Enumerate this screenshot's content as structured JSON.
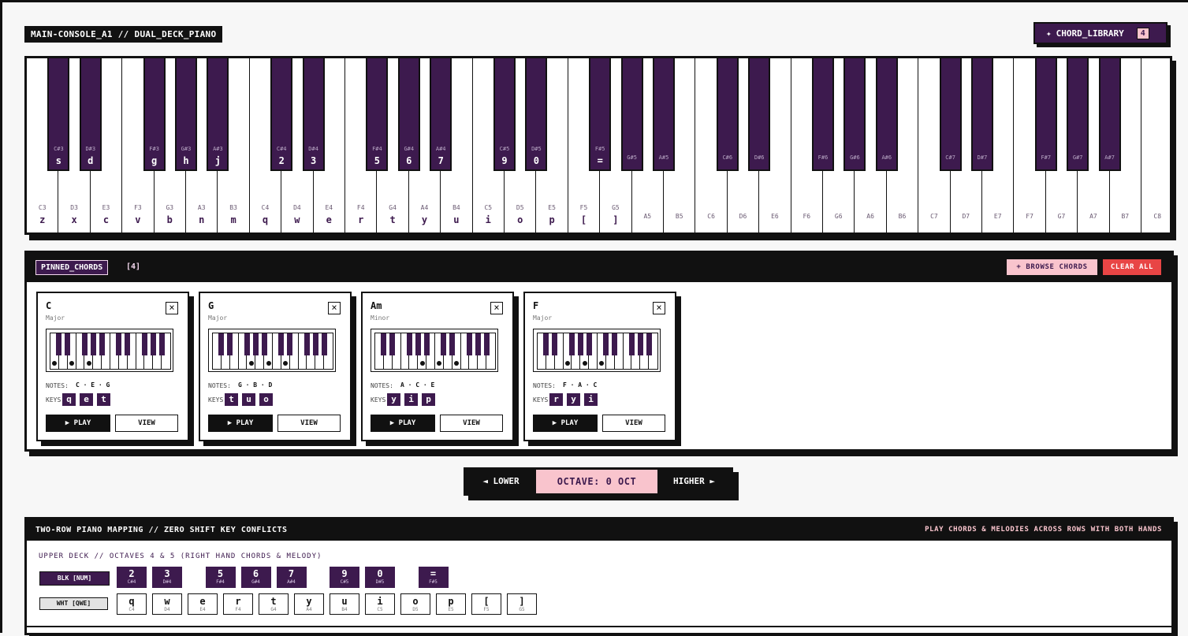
{
  "header": {
    "console_title": "MAIN-CONSOLE_A1 // DUAL_DECK_PIANO",
    "chord_library_label": "CHORD_LIBRARY",
    "chord_library_count": "4",
    "chord_library_icon": "sparkle-icon"
  },
  "keyboard": {
    "white_keys": [
      {
        "note": "C3",
        "key": "z"
      },
      {
        "note": "D3",
        "key": "x"
      },
      {
        "note": "E3",
        "key": "c"
      },
      {
        "note": "F3",
        "key": "v"
      },
      {
        "note": "G3",
        "key": "b"
      },
      {
        "note": "A3",
        "key": "n"
      },
      {
        "note": "B3",
        "key": "m"
      },
      {
        "note": "C4",
        "key": "q"
      },
      {
        "note": "D4",
        "key": "w"
      },
      {
        "note": "E4",
        "key": "e"
      },
      {
        "note": "F4",
        "key": "r"
      },
      {
        "note": "G4",
        "key": "t"
      },
      {
        "note": "A4",
        "key": "y"
      },
      {
        "note": "B4",
        "key": "u"
      },
      {
        "note": "C5",
        "key": "i"
      },
      {
        "note": "D5",
        "key": "o"
      },
      {
        "note": "E5",
        "key": "p"
      },
      {
        "note": "F5",
        "key": "["
      },
      {
        "note": "G5",
        "key": "]"
      },
      {
        "note": "A5",
        "key": ""
      },
      {
        "note": "B5",
        "key": ""
      },
      {
        "note": "C6",
        "key": ""
      },
      {
        "note": "D6",
        "key": ""
      },
      {
        "note": "E6",
        "key": ""
      },
      {
        "note": "F6",
        "key": ""
      },
      {
        "note": "G6",
        "key": ""
      },
      {
        "note": "A6",
        "key": ""
      },
      {
        "note": "B6",
        "key": ""
      },
      {
        "note": "C7",
        "key": ""
      },
      {
        "note": "D7",
        "key": ""
      },
      {
        "note": "E7",
        "key": ""
      },
      {
        "note": "F7",
        "key": ""
      },
      {
        "note": "G7",
        "key": ""
      },
      {
        "note": "A7",
        "key": ""
      },
      {
        "note": "B7",
        "key": ""
      },
      {
        "note": "C8",
        "key": ""
      }
    ],
    "black_keys": [
      {
        "note": "C#3",
        "key": "s"
      },
      {
        "note": "D#3",
        "key": "d"
      },
      {
        "note": "F#3",
        "key": "g"
      },
      {
        "note": "G#3",
        "key": "h"
      },
      {
        "note": "A#3",
        "key": "j"
      },
      {
        "note": "C#4",
        "key": "2"
      },
      {
        "note": "D#4",
        "key": "3"
      },
      {
        "note": "F#4",
        "key": "5"
      },
      {
        "note": "G#4",
        "key": "6"
      },
      {
        "note": "A#4",
        "key": "7"
      },
      {
        "note": "C#5",
        "key": "9"
      },
      {
        "note": "D#5",
        "key": "0"
      },
      {
        "note": "F#5",
        "key": "="
      },
      {
        "note": "G#5",
        "key": ""
      },
      {
        "note": "A#5",
        "key": ""
      },
      {
        "note": "C#6",
        "key": ""
      },
      {
        "note": "D#6",
        "key": ""
      },
      {
        "note": "F#6",
        "key": ""
      },
      {
        "note": "G#6",
        "key": ""
      },
      {
        "note": "A#6",
        "key": ""
      },
      {
        "note": "C#7",
        "key": ""
      },
      {
        "note": "D#7",
        "key": ""
      },
      {
        "note": "F#7",
        "key": ""
      },
      {
        "note": "G#7",
        "key": ""
      },
      {
        "note": "A#7",
        "key": ""
      }
    ]
  },
  "pinned": {
    "tag": "PINNED_CHORDS",
    "count": "[4]",
    "browse_label": "+ BROWSE CHORDS",
    "clear_label": "CLEAR ALL",
    "notes_label": "NOTES:",
    "keys_label": "KEYS:",
    "play_label": "▶ PLAY",
    "view_label": "VIEW",
    "close_label": "×",
    "cards": [
      {
        "name": "C",
        "type": "Major",
        "notes": "C · E · G",
        "keys": [
          "q",
          "e",
          "t"
        ]
      },
      {
        "name": "G",
        "type": "Major",
        "notes": "G · B · D",
        "keys": [
          "t",
          "u",
          "o"
        ]
      },
      {
        "name": "Am",
        "type": "Minor",
        "notes": "A · C · E",
        "keys": [
          "y",
          "i",
          "p"
        ]
      },
      {
        "name": "F",
        "type": "Major",
        "notes": "F · A · C",
        "keys": [
          "r",
          "y",
          "i"
        ]
      }
    ]
  },
  "octave": {
    "lower_label": "◄ LOWER",
    "value_label": "OCTAVE: 0 OCT",
    "higher_label": "HIGHER ►"
  },
  "mapping": {
    "title": "TWO-ROW PIANO MAPPING // ZERO SHIFT KEY CONFLICTS",
    "subtitle": "PLAY CHORDS & MELODIES ACROSS ROWS WITH BOTH HANDS",
    "deck_label": "UPPER DECK // OCTAVES 4 & 5 (RIGHT HAND CHORDS & MELODY)",
    "blk_label": "BLK [NUM]",
    "wht_label": "WHT [QWE]",
    "black_row": [
      {
        "key": "2",
        "note": "C#4"
      },
      {
        "key": "3",
        "note": "D#4"
      },
      {
        "key": "5",
        "note": "F#4"
      },
      {
        "key": "6",
        "note": "G#4"
      },
      {
        "key": "7",
        "note": "A#4"
      },
      {
        "key": "9",
        "note": "C#5"
      },
      {
        "key": "0",
        "note": "D#5"
      },
      {
        "key": "=",
        "note": "F#5"
      }
    ],
    "white_row": [
      {
        "key": "q",
        "note": "C4"
      },
      {
        "key": "w",
        "note": "D4"
      },
      {
        "key": "e",
        "note": "E4"
      },
      {
        "key": "r",
        "note": "F4"
      },
      {
        "key": "t",
        "note": "G4"
      },
      {
        "key": "y",
        "note": "A4"
      },
      {
        "key": "u",
        "note": "B4"
      },
      {
        "key": "i",
        "note": "C5"
      },
      {
        "key": "o",
        "note": "D5"
      },
      {
        "key": "p",
        "note": "E5"
      },
      {
        "key": "[",
        "note": "F5"
      },
      {
        "key": "]",
        "note": "G5"
      }
    ]
  },
  "colors": {
    "accent": "#3d1a4e",
    "pink": "#f9c4cd",
    "danger": "#e84545"
  }
}
